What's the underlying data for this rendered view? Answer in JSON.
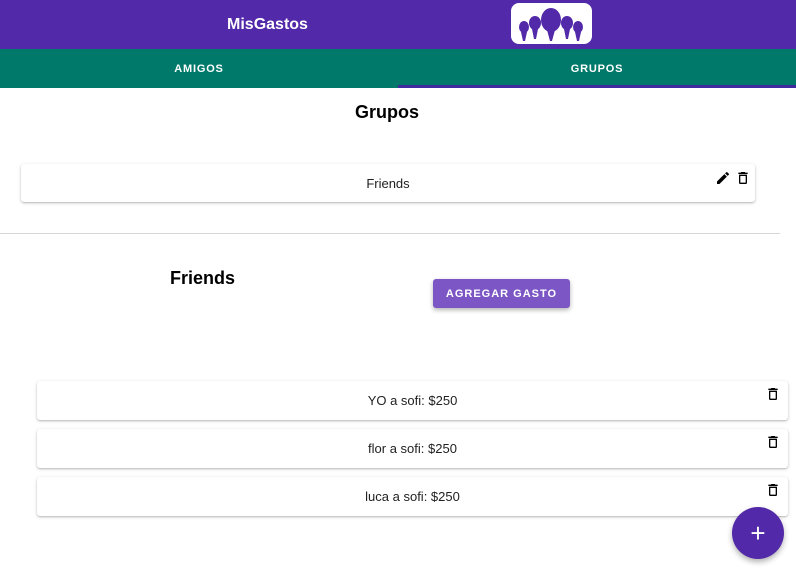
{
  "appbar": {
    "title": "MisGastos",
    "logo_icon": "group-people-icon"
  },
  "tabs": [
    {
      "label": "AMIGOS",
      "selected": false
    },
    {
      "label": "GRUPOS",
      "selected": true
    }
  ],
  "groups_section": {
    "title": "Grupos",
    "items": [
      {
        "name": "Friends",
        "edit_icon": "pencil-icon",
        "delete_icon": "trash-icon"
      }
    ]
  },
  "group_detail": {
    "title": "Friends",
    "add_expense_label": "AGREGAR GASTO",
    "expenses": [
      {
        "text": "YO a sofi: $250",
        "delete_icon": "trash-icon"
      },
      {
        "text": "flor a sofi: $250",
        "delete_icon": "trash-icon"
      },
      {
        "text": "luca a sofi: $250",
        "delete_icon": "trash-icon"
      }
    ]
  },
  "fab": {
    "label": "+"
  },
  "colors": {
    "primary": "#5229a8",
    "tabs": "#00796b",
    "button": "#7b56c4"
  }
}
